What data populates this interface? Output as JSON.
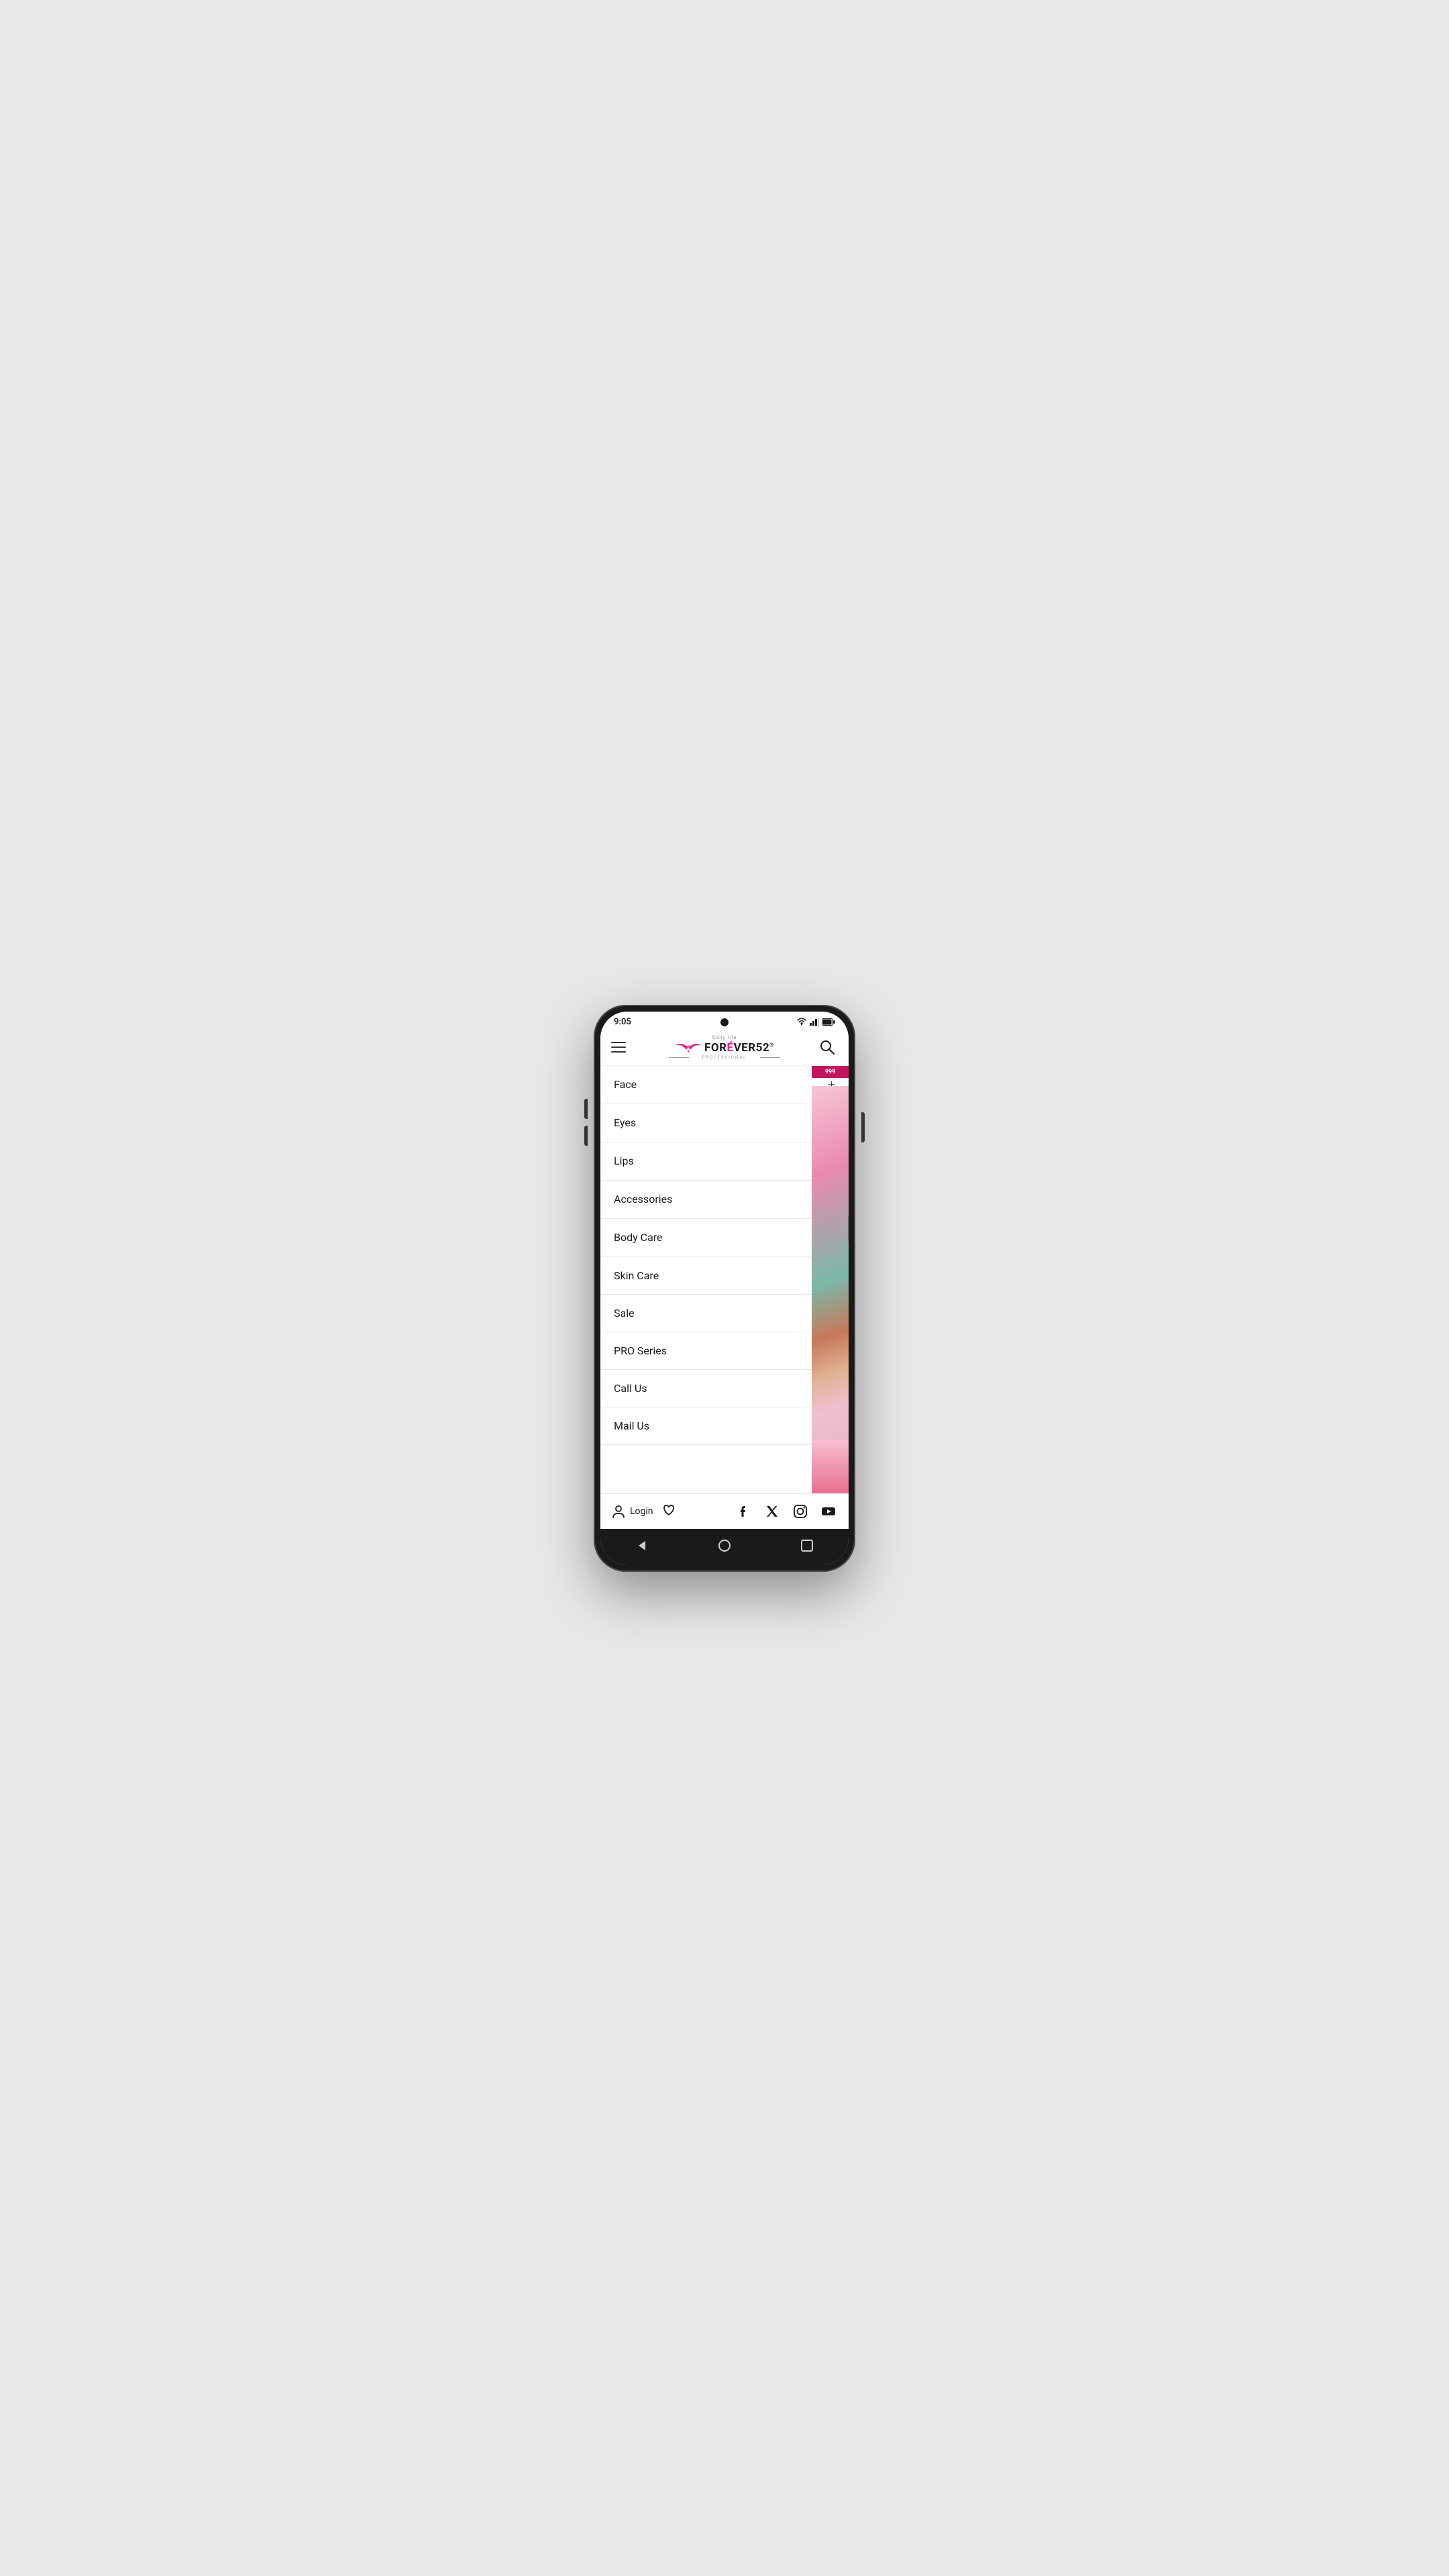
{
  "status": {
    "time": "9:05",
    "battery_icon": "🔋",
    "wifi": true,
    "signal": true
  },
  "header": {
    "menu_label": "Menu",
    "logo_daily_life": "Daily life",
    "logo_text": "FORÉVER52",
    "logo_registered": "®",
    "logo_professional": "PROFESSIONAL",
    "search_label": "Search"
  },
  "menu_items": [
    {
      "id": "face",
      "label": "Face",
      "has_expand": true
    },
    {
      "id": "eyes",
      "label": "Eyes",
      "has_expand": true
    },
    {
      "id": "lips",
      "label": "Lips",
      "has_expand": true
    },
    {
      "id": "accessories",
      "label": "Accessories",
      "has_expand": true
    },
    {
      "id": "body-care",
      "label": "Body Care",
      "has_expand": true
    },
    {
      "id": "skin-care",
      "label": "Skin Care",
      "has_expand": false
    },
    {
      "id": "sale",
      "label": "Sale",
      "has_expand": false
    },
    {
      "id": "pro-series",
      "label": "PRO Series",
      "has_expand": false
    },
    {
      "id": "call-us",
      "label": "Call Us",
      "has_expand": false
    },
    {
      "id": "mail-us",
      "label": "Mail Us",
      "has_expand": false
    }
  ],
  "bottom_bar": {
    "login_label": "Login",
    "user_icon": "👤",
    "heart_icon": "♡"
  },
  "social": [
    {
      "id": "facebook",
      "label": "Facebook"
    },
    {
      "id": "twitter-x",
      "label": "X (Twitter)"
    },
    {
      "id": "instagram",
      "label": "Instagram"
    },
    {
      "id": "youtube",
      "label": "YouTube"
    }
  ],
  "android_nav": {
    "back_label": "Back",
    "home_label": "Home",
    "recents_label": "Recents"
  },
  "sale_banner": {
    "text": "999"
  },
  "colors": {
    "brand_pink": "#e91e8c",
    "text_dark": "#1a1a1a",
    "divider": "#e8e8e8",
    "bg_white": "#ffffff"
  }
}
